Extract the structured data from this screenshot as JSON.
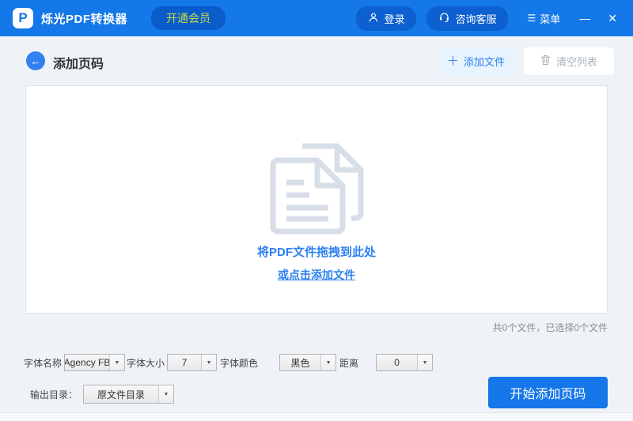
{
  "colors": {
    "titlebar_blue": "#1478e8",
    "pill_blue": "#0c60d0",
    "vip_text_green": "#c5d94a",
    "accent_blue": "#2f82f0",
    "primary_button_blue": "#1677eb",
    "page_background": "#eff3f7",
    "doc_icon_gray": "#d7dee8"
  },
  "titlebar": {
    "logo_letter": "P",
    "app_name": "烁光PDF转换器",
    "vip_button": "开通会员",
    "login_button": "登录",
    "support_button": "咨询客服",
    "menu_glyph": "☰",
    "menu_label": "菜单",
    "minimize_glyph": "—",
    "close_glyph": "✕"
  },
  "header": {
    "back_glyph": "←",
    "title": "添加页码",
    "add_file_plus": "＋",
    "add_file_button": "添加文件",
    "clear_list_button": "清空列表"
  },
  "dropzone": {
    "hint_line1": "将PDF文件拖拽到此处",
    "hint_line2": "或点击添加文件"
  },
  "status": {
    "file_count": "共0个文件，已选择0个文件"
  },
  "settings": {
    "font_name_label": "字体名称",
    "font_name_value": "Agency FB",
    "font_size_label": "字体大小",
    "font_size_value": "7",
    "font_color_label": "字体颜色",
    "font_color_value": "黑色",
    "distance_label": "距离",
    "distance_value": "0",
    "output_dir_label": "输出目录：",
    "output_dir_value": "原文件目录",
    "dropdown_arrow": "▼"
  },
  "action": {
    "start_button": "开始添加页码"
  }
}
